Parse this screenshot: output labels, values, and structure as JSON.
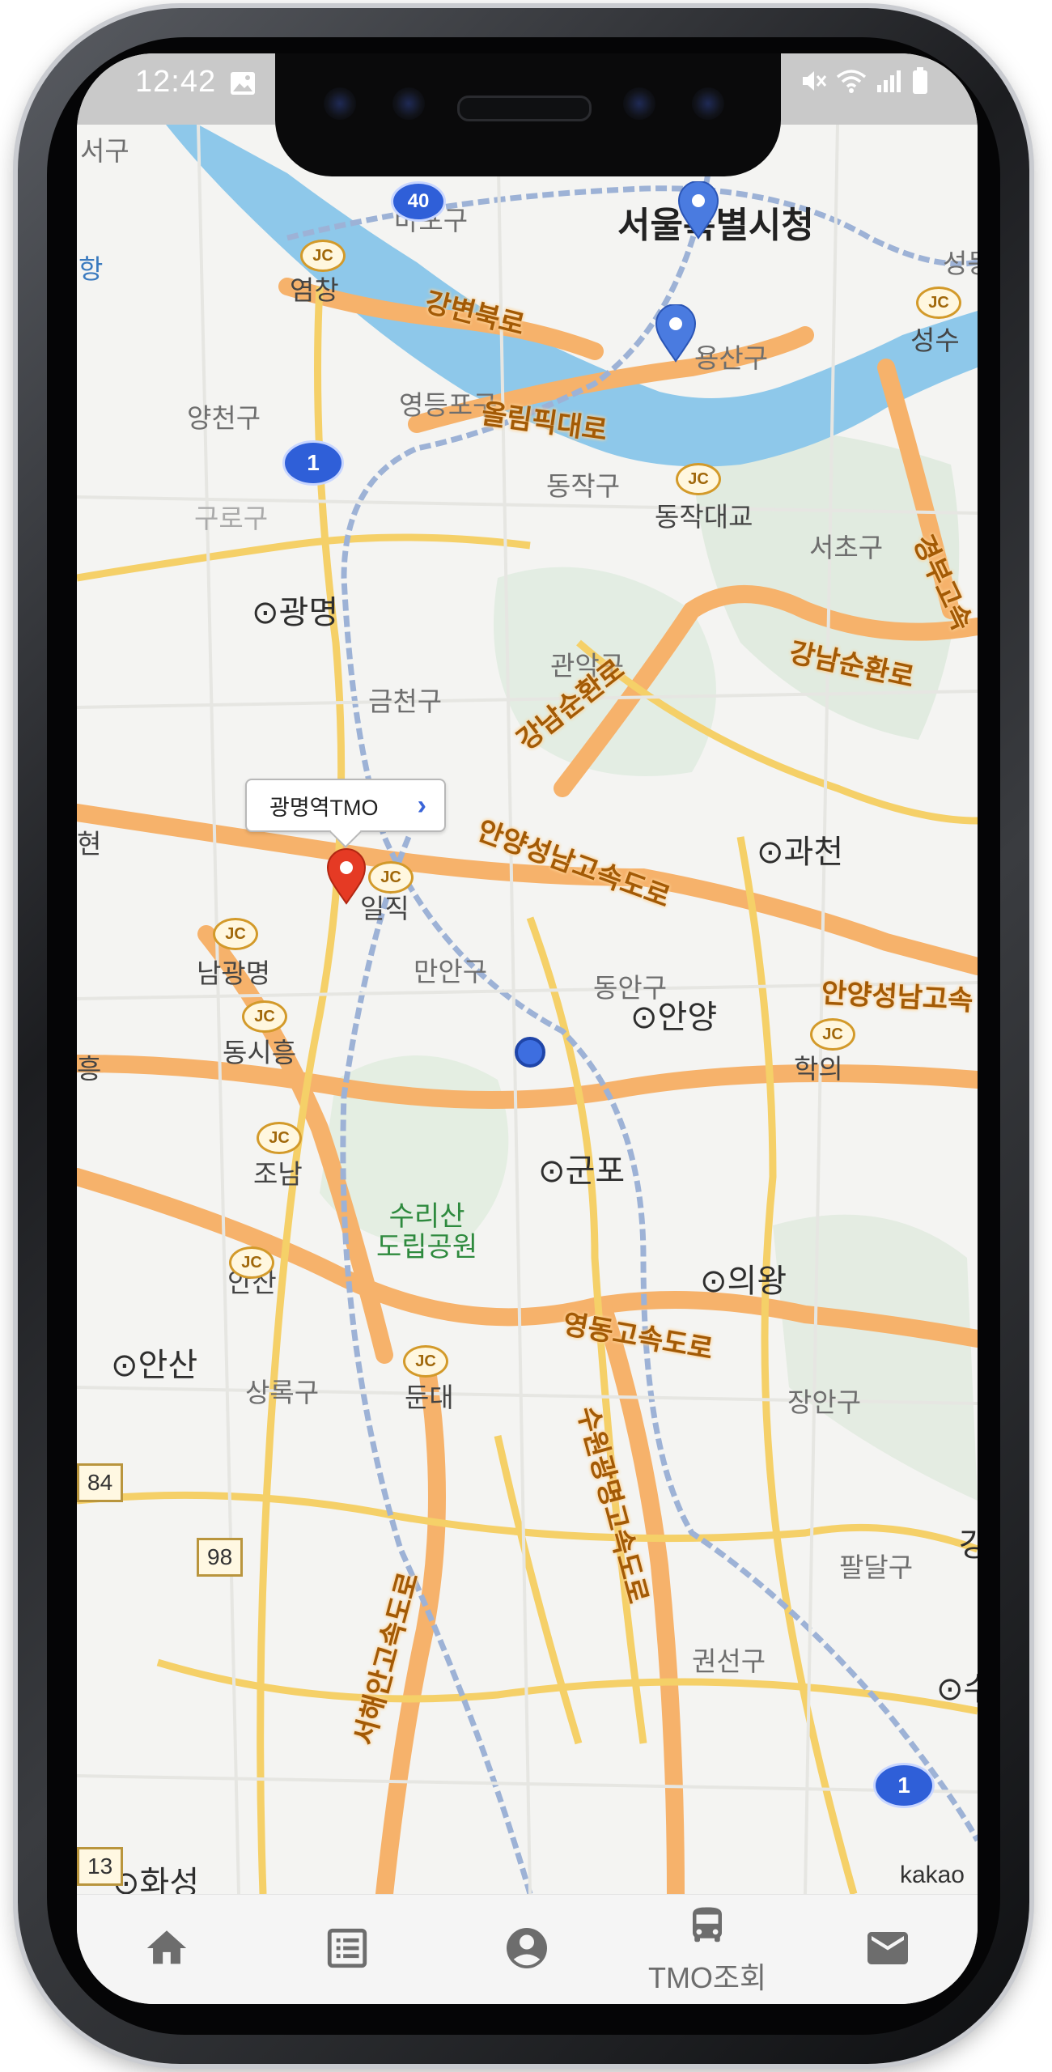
{
  "status_bar": {
    "time": "12:42"
  },
  "map": {
    "callout": {
      "label": "광명역TMO"
    },
    "watermark": "kakao",
    "labels": {
      "seoul_cityhall": "서울특별시청",
      "mapo": "마포구",
      "seogu": "서구",
      "hang": "항",
      "yeomchang": "염창",
      "yangcheon": "양천구",
      "yeongdeungpo": "영등포구",
      "yongsan": "용산구",
      "seongsu": "성수",
      "seong": "성동",
      "dongjak": "동작구",
      "dongjak_bridge": "동작대교",
      "seocho": "서초구",
      "guro": "구로구",
      "gwangmyeong": "광명",
      "geumcheon": "금천구",
      "gwanak": "관악구",
      "gwacheon": "과천",
      "iljik": "일직",
      "manan": "만안구",
      "dongan": "동안구",
      "anyang": "안양",
      "namgwangmyeong": "남광명",
      "dongsiheung": "동시흥",
      "hakui": "학의",
      "heung": "흥",
      "hyeon": "현",
      "jonam": "조남",
      "gunpo": "군포",
      "surisan": "수리산\n도립공원",
      "uiwang": "의왕",
      "ansan_jc": "안산",
      "ansan": "안산",
      "sangnok": "상록구",
      "dundae": "둔대",
      "jangan": "장안구",
      "paldal": "팔달구",
      "gwonseon": "권선구",
      "su": "수",
      "gang": "강",
      "hwaseong": "화성"
    },
    "roads": {
      "gangbyeonbuk": "강변북로",
      "olympic": "올림픽대로",
      "gangnamsunhwan": "강남순환로",
      "gangnamsunhwan_west": "강남순환로",
      "anyang_seongnam": "안양성남고속도로",
      "anyang_seongnam_east": "안양성남고속",
      "yeongdong": "영동고속도로",
      "suwon_gwangmyeong": "수원광명고속도로",
      "seohaean": "서해안고속도로",
      "gyeongbu": "경부고속"
    },
    "route_shields": {
      "r1a": "1",
      "r1b": "1",
      "r40": "40",
      "r84": "84",
      "r98": "98",
      "r13": "13"
    },
    "jc_marker": "JC"
  },
  "bottom_nav": {
    "items": [
      {
        "icon": "home-icon",
        "label": ""
      },
      {
        "icon": "list-icon",
        "label": ""
      },
      {
        "icon": "account-icon",
        "label": ""
      },
      {
        "icon": "bus-icon",
        "label": "TMO조회"
      },
      {
        "icon": "mail-icon",
        "label": ""
      }
    ],
    "active_color": "#6d6d6d"
  },
  "colors": {
    "highway": "#f6b26b",
    "arterial": "#f5d068",
    "river": "#8ec8ea",
    "rail": "#9db2d6",
    "pin_red": "#e53a24",
    "pin_blue": "#4a7be0"
  }
}
